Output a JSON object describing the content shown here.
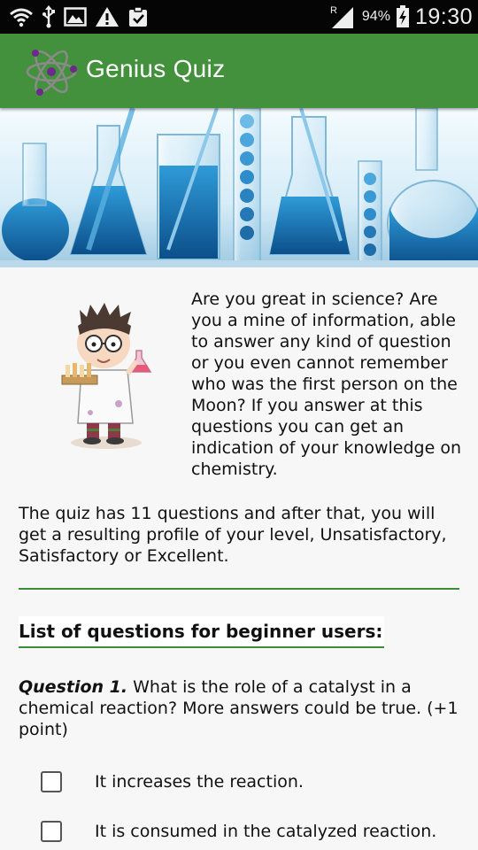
{
  "status_bar": {
    "icons": [
      "wifi-icon",
      "usb-icon",
      "image-icon",
      "warning-icon",
      "clipboard-icon",
      "signal-icon",
      "battery-icon"
    ],
    "roaming_indicator": "R",
    "battery": "94%",
    "time": "19:30"
  },
  "app_bar": {
    "title": "Genius Quiz",
    "logo": "atom-icon",
    "color": "#43913c"
  },
  "main": {
    "intro": "Are you great in science? Are you a mine of information, able to answer any kind of question or you even cannot remember who was the first person on the Moon? If you answer at this questions you can get an indication of your knowledge on chemistry.",
    "summary": "The quiz has 11 questions and after that, you will get a resulting profile of your level, Unsatisfactory, Satisfactory or Excellent.",
    "section_title": "List of questions for beginner users:",
    "question": {
      "label": "Question 1.",
      "text": " What is the role of a catalyst in a chemical reaction? More answers could be true. (+1 point)"
    },
    "options": [
      {
        "label": "It increases the reaction.",
        "checked": false
      },
      {
        "label": "It is consumed in the catalyzed reaction.",
        "checked": false
      }
    ]
  }
}
